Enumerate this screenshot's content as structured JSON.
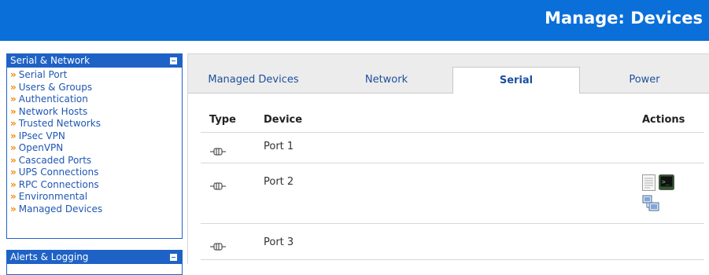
{
  "header": {
    "title": "Manage: Devices"
  },
  "sidebar": {
    "section1_title": "Serial & Network",
    "items": [
      "Serial Port",
      "Users & Groups",
      "Authentication",
      "Network Hosts",
      "Trusted Networks",
      "IPsec VPN",
      "OpenVPN",
      "Cascaded Ports",
      "UPS Connections",
      "RPC Connections",
      "Environmental",
      "Managed Devices"
    ],
    "section2_title": "Alerts & Logging"
  },
  "tabs": {
    "t1": "Managed Devices",
    "t2": "Network",
    "t3": "Serial",
    "t4": "Power",
    "active": "Serial"
  },
  "table": {
    "col_type": "Type",
    "col_device": "Device",
    "col_actions": "Actions",
    "rows": [
      {
        "device": "Port 1",
        "type_icon": "serial-port-icon",
        "actions": []
      },
      {
        "device": "Port 2",
        "type_icon": "serial-port-icon",
        "actions": [
          "document-icon",
          "terminal-icon",
          "network-computers-icon"
        ]
      },
      {
        "device": "Port 3",
        "type_icon": "serial-port-icon",
        "actions": []
      }
    ]
  },
  "colors": {
    "topbar": "#0a6fd8",
    "sidebar_header": "#1f62c6",
    "link": "#1e57b4",
    "bullet": "#f08a00"
  }
}
